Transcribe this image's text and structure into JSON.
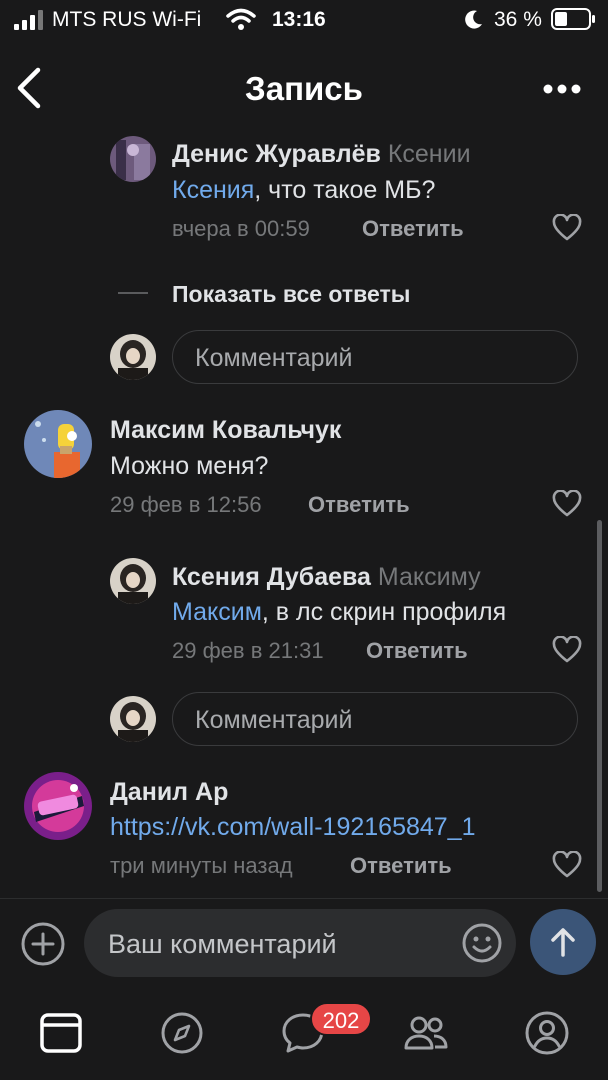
{
  "status_bar": {
    "carrier": "MTS RUS Wi-Fi",
    "time": "13:16",
    "battery": "36 %"
  },
  "header": {
    "title": "Запись"
  },
  "comments": [
    {
      "author": "Денис Журавлёв",
      "reply_to": "Ксении",
      "mention": "Ксения",
      "text": ", что такое МБ?",
      "time": "вчера в 00:59",
      "reply_label": "Ответить"
    },
    {
      "author": "Максим Ковальчук",
      "text": "Можно меня?",
      "time": "29 фев в 12:56",
      "reply_label": "Ответить"
    },
    {
      "author": "Ксения Дубаева",
      "reply_to": "Максиму",
      "mention": "Максим",
      "text": ", в лс скрин профиля",
      "time": "29 фев в 21:31",
      "reply_label": "Ответить"
    },
    {
      "author": "Данил Ар",
      "link": "https://vk.com/wall-192165847_1",
      "time": "три минуты назад",
      "reply_label": "Ответить"
    }
  ],
  "show_all_replies": "Показать все ответы",
  "comment_placeholder": "Комментарий",
  "composer": {
    "placeholder": "Ваш комментарий"
  },
  "tabbar": {
    "messages_badge": "202"
  },
  "colors": {
    "background": "#19191a",
    "accent_link": "#71aaeb",
    "badge": "#e64646",
    "send_button": "#3b5578"
  },
  "icons": [
    "signal-icon",
    "wifi-icon",
    "moon-icon",
    "battery-icon",
    "back-icon",
    "more-icon",
    "heart-icon",
    "add-icon",
    "emoji-icon",
    "send-icon",
    "feed-icon",
    "discover-icon",
    "messages-icon",
    "friends-icon",
    "profile-icon"
  ]
}
